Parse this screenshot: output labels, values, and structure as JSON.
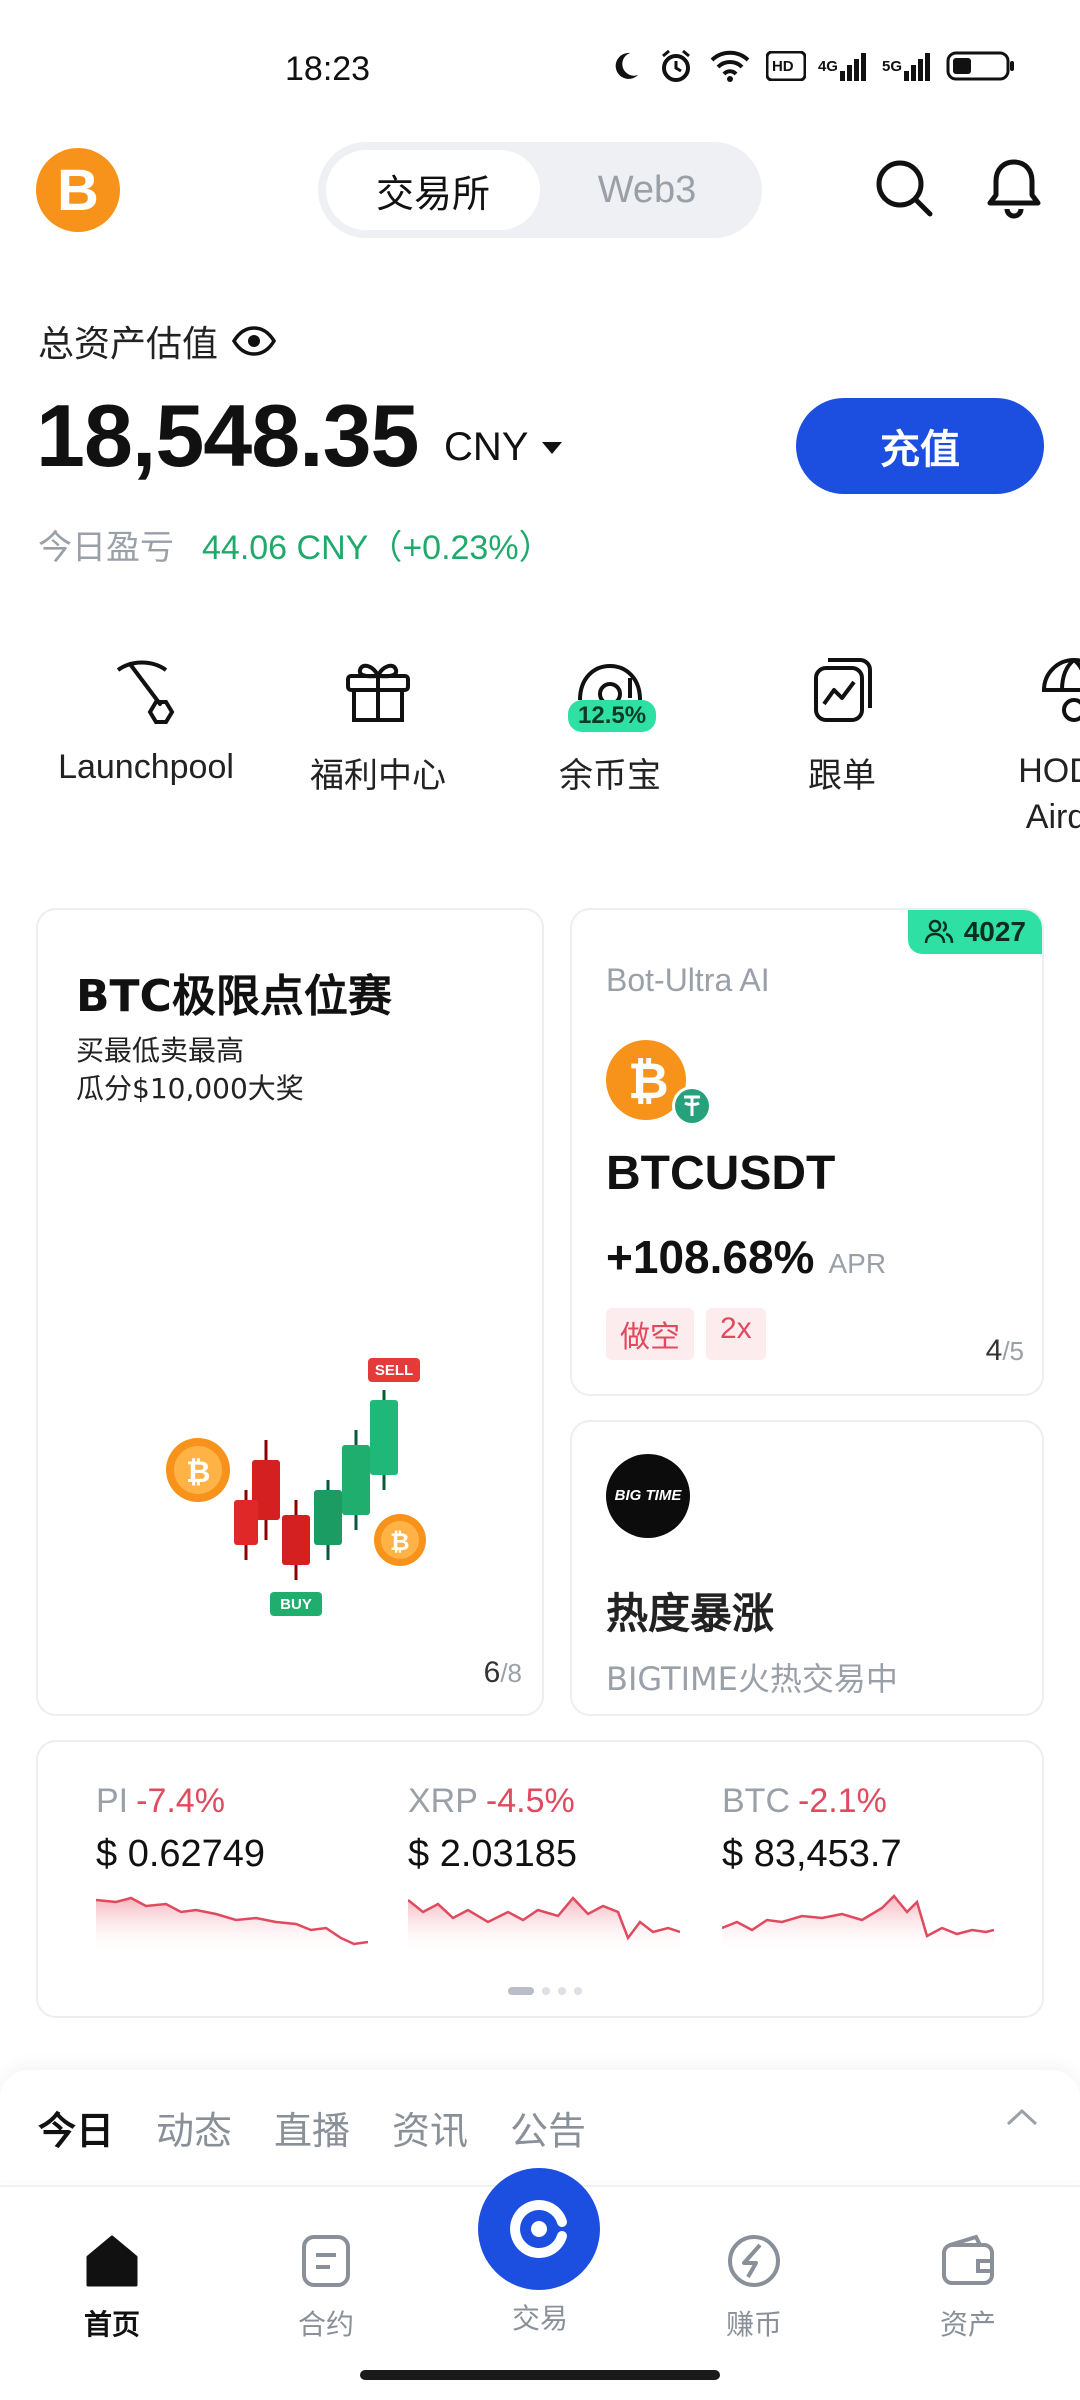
{
  "status_bar": {
    "time": "18:23",
    "icons": [
      "moon-icon",
      "alarm-icon",
      "wifi-icon",
      "hd-icon",
      "signal-4g-icon",
      "signal-5g-icon",
      "battery-icon"
    ],
    "hd_label": "HD",
    "net1_label": "4G",
    "net2_label": "5G"
  },
  "header": {
    "logo_letter": "B",
    "segments": [
      "交易所",
      "Web3"
    ],
    "active_segment": "交易所"
  },
  "assets": {
    "label": "总资产估值",
    "balance": "18,548.35",
    "currency": "CNY",
    "deposit_label": "充值",
    "pnl_label": "今日盈亏",
    "pnl_value": "44.06 CNY（+0.23%）"
  },
  "shortcuts": [
    {
      "label": "Launchpool",
      "icon": "pickaxe-icon"
    },
    {
      "label": "福利中心",
      "icon": "gift-icon"
    },
    {
      "label": "余币宝",
      "icon": "coin-box-icon",
      "badge": "12.5%"
    },
    {
      "label": "跟单",
      "icon": "copy-trade-icon"
    },
    {
      "label": "HOD Aird",
      "icon": "airdrop-icon"
    }
  ],
  "promo_card": {
    "title": "BTC极限点位赛",
    "subtitle_line1": "买最低卖最高",
    "subtitle_line2": "瓜分$10,000大奖",
    "sell_tag": "SELL",
    "buy_tag": "BUY",
    "page_current": "6",
    "page_total": "/8"
  },
  "bot_card": {
    "participants": "4027",
    "label": "Bot-Ultra AI",
    "pair": "BTCUSDT",
    "apr_value": "+108.68%",
    "apr_unit": "APR",
    "tags": [
      "做空",
      "2x"
    ],
    "page_current": "4",
    "page_total": "/5"
  },
  "hot_card": {
    "logo_text": "BIG TIME",
    "title": "热度暴涨",
    "subtitle": "BIGTIME火热交易中"
  },
  "tickers": [
    {
      "symbol": "PI",
      "change": "-7.4%",
      "price": "$ 0.62749"
    },
    {
      "symbol": "XRP",
      "change": "-4.5%",
      "price": "$ 2.03185"
    },
    {
      "symbol": "BTC",
      "change": "-2.1%",
      "price": "$ 83,453.7"
    }
  ],
  "news_tabs": [
    "今日",
    "动态",
    "直播",
    "资讯",
    "公告"
  ],
  "bottom_nav": [
    {
      "label": "首页",
      "icon": "home-icon"
    },
    {
      "label": "合约",
      "icon": "contract-icon"
    },
    {
      "label": "交易",
      "icon": "trade-icon"
    },
    {
      "label": "赚币",
      "icon": "earn-icon"
    },
    {
      "label": "资产",
      "icon": "wallet-icon"
    }
  ],
  "colors": {
    "primary": "#1c4fe0",
    "up": "#1fa96b",
    "down": "#e04a5e",
    "badge_green": "#2fe0a4",
    "btc_orange": "#f7931a"
  }
}
